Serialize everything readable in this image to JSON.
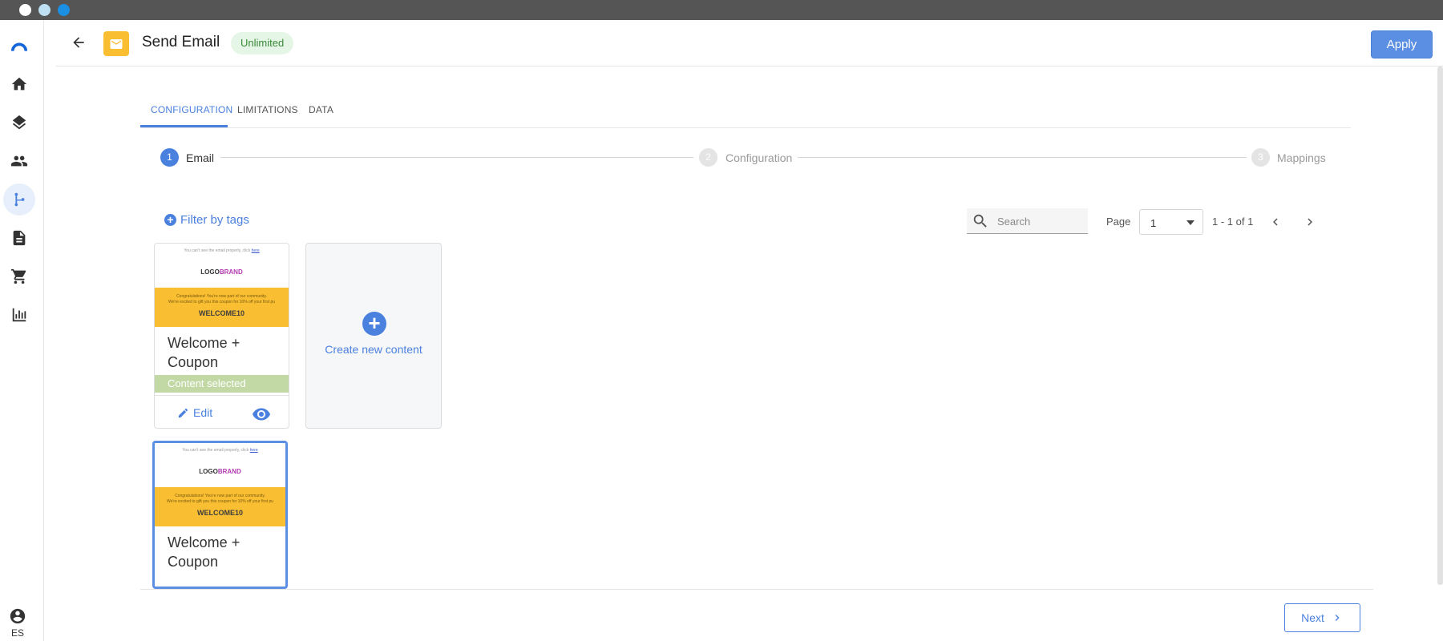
{
  "header": {
    "title": "Send Email",
    "plan_badge": "Unlimited",
    "apply_label": "Apply"
  },
  "sidebar": {
    "items": [
      {
        "name": "home",
        "icon": "home-icon"
      },
      {
        "name": "layers",
        "icon": "layers-icon"
      },
      {
        "name": "people",
        "icon": "people-icon"
      },
      {
        "name": "flows",
        "icon": "flow-branch-icon",
        "active": true
      },
      {
        "name": "documents",
        "icon": "document-icon"
      },
      {
        "name": "shop",
        "icon": "cart-icon"
      },
      {
        "name": "analytics",
        "icon": "bar-chart-icon"
      }
    ],
    "language": "ES"
  },
  "tabs": [
    {
      "label": "CONFIGURATION",
      "active": true
    },
    {
      "label": "LIMITATIONS",
      "active": false
    },
    {
      "label": "DATA",
      "active": false
    }
  ],
  "stepper": [
    {
      "number": "1",
      "label": "Email",
      "active": true
    },
    {
      "number": "2",
      "label": "Configuration",
      "active": false
    },
    {
      "number": "3",
      "label": "Mappings",
      "active": false
    }
  ],
  "toolbar": {
    "filter_label": "Filter by tags",
    "search_placeholder": "Search",
    "page_label": "Page",
    "page_value": "1",
    "range_text": "1 - 1 of 1"
  },
  "cards": [
    {
      "preview_top": "You can't see the email properly, click",
      "preview_top_link": "here",
      "logo": "LOGO",
      "brand": "BRAND",
      "banner_line1": "Congratulations! You're now part of our community.",
      "banner_line2": "We're excited to gift you this coupon for 10% off your first pu",
      "coupon_code": "WELCOME10",
      "title": "Welcome + Coupon",
      "selected_label": "Content selected",
      "edit_label": "Edit"
    },
    {
      "preview_top": "You can't see the email properly, click",
      "preview_top_link": "here",
      "logo": "LOGO",
      "brand": "BRAND",
      "banner_line1": "Congratulations! You're now part of our community.",
      "banner_line2": "We're excited to gift you this coupon for 10% off your first pu",
      "coupon_code": "WELCOME10",
      "title": "Welcome + Coupon"
    }
  ],
  "new_content_label": "Create new content",
  "footer": {
    "next_label": "Next"
  },
  "colors": {
    "accent": "#4a80de",
    "email_badge": "#f9be32",
    "selected_bar": "#c2d9a6",
    "plan_badge_bg": "#e6f6e6"
  }
}
